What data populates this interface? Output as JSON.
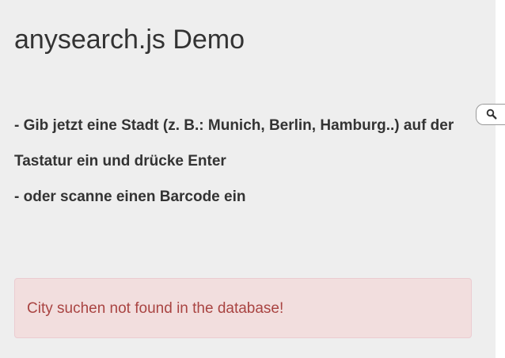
{
  "header": {
    "title": "anysearch.js Demo"
  },
  "instructions": {
    "line1": "- Gib jetzt eine Stadt (z. B.: Munich, Berlin, Hamburg..) auf der Tastatur ein und drücke Enter",
    "line2": "- oder scanne einen Barcode ein"
  },
  "alert": {
    "message": "City suchen not found in the database!"
  },
  "search_tab": {
    "icon": "search-icon"
  },
  "colors": {
    "page_background": "#eeeeee",
    "text": "#333333",
    "alert_background": "#f2dede",
    "alert_border": "#ebccd1",
    "alert_text": "#a94442"
  }
}
